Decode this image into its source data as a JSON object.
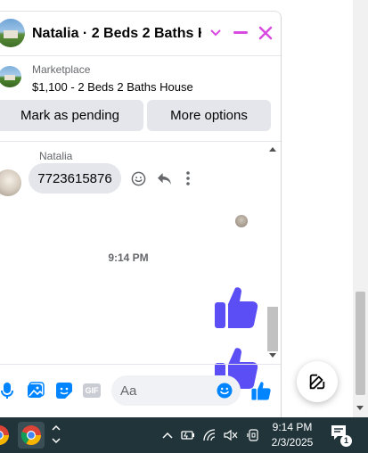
{
  "chat": {
    "title": "Natalia · 2 Beds 2 Baths H...",
    "marketplace": {
      "source": "Marketplace",
      "listing": "$1,100 - 2 Beds 2 Baths House",
      "mark_pending_label": "Mark as pending",
      "more_options_label": "More options"
    },
    "messages": {
      "sender": "Natalia",
      "text": "7723615876",
      "timestamp": "9:14 PM"
    },
    "composer": {
      "placeholder": "Aa",
      "gif_label": "GIF"
    }
  },
  "colors": {
    "accent": "#0084ff",
    "like": "#5b4ef5",
    "header_icons": "#d84ae0",
    "taskbar": "#20343a"
  },
  "icons": {
    "header": [
      "chevron-down-icon",
      "minimize-icon",
      "close-icon"
    ],
    "message_actions": [
      "emoji-icon",
      "reply-icon",
      "more-icon"
    ],
    "composer": [
      "microphone-icon",
      "photo-icon",
      "sticker-icon",
      "gif-icon",
      "emoji-icon",
      "thumbs-up-icon"
    ],
    "fab": "compose-icon",
    "tray": [
      "chevron-up-icon",
      "battery-icon",
      "wifi-icon",
      "volume-muted-icon",
      "display-icon",
      "notification-icon"
    ]
  },
  "taskbar": {
    "time": "9:14 PM",
    "date": "2/3/2025",
    "notification_count": "1"
  }
}
